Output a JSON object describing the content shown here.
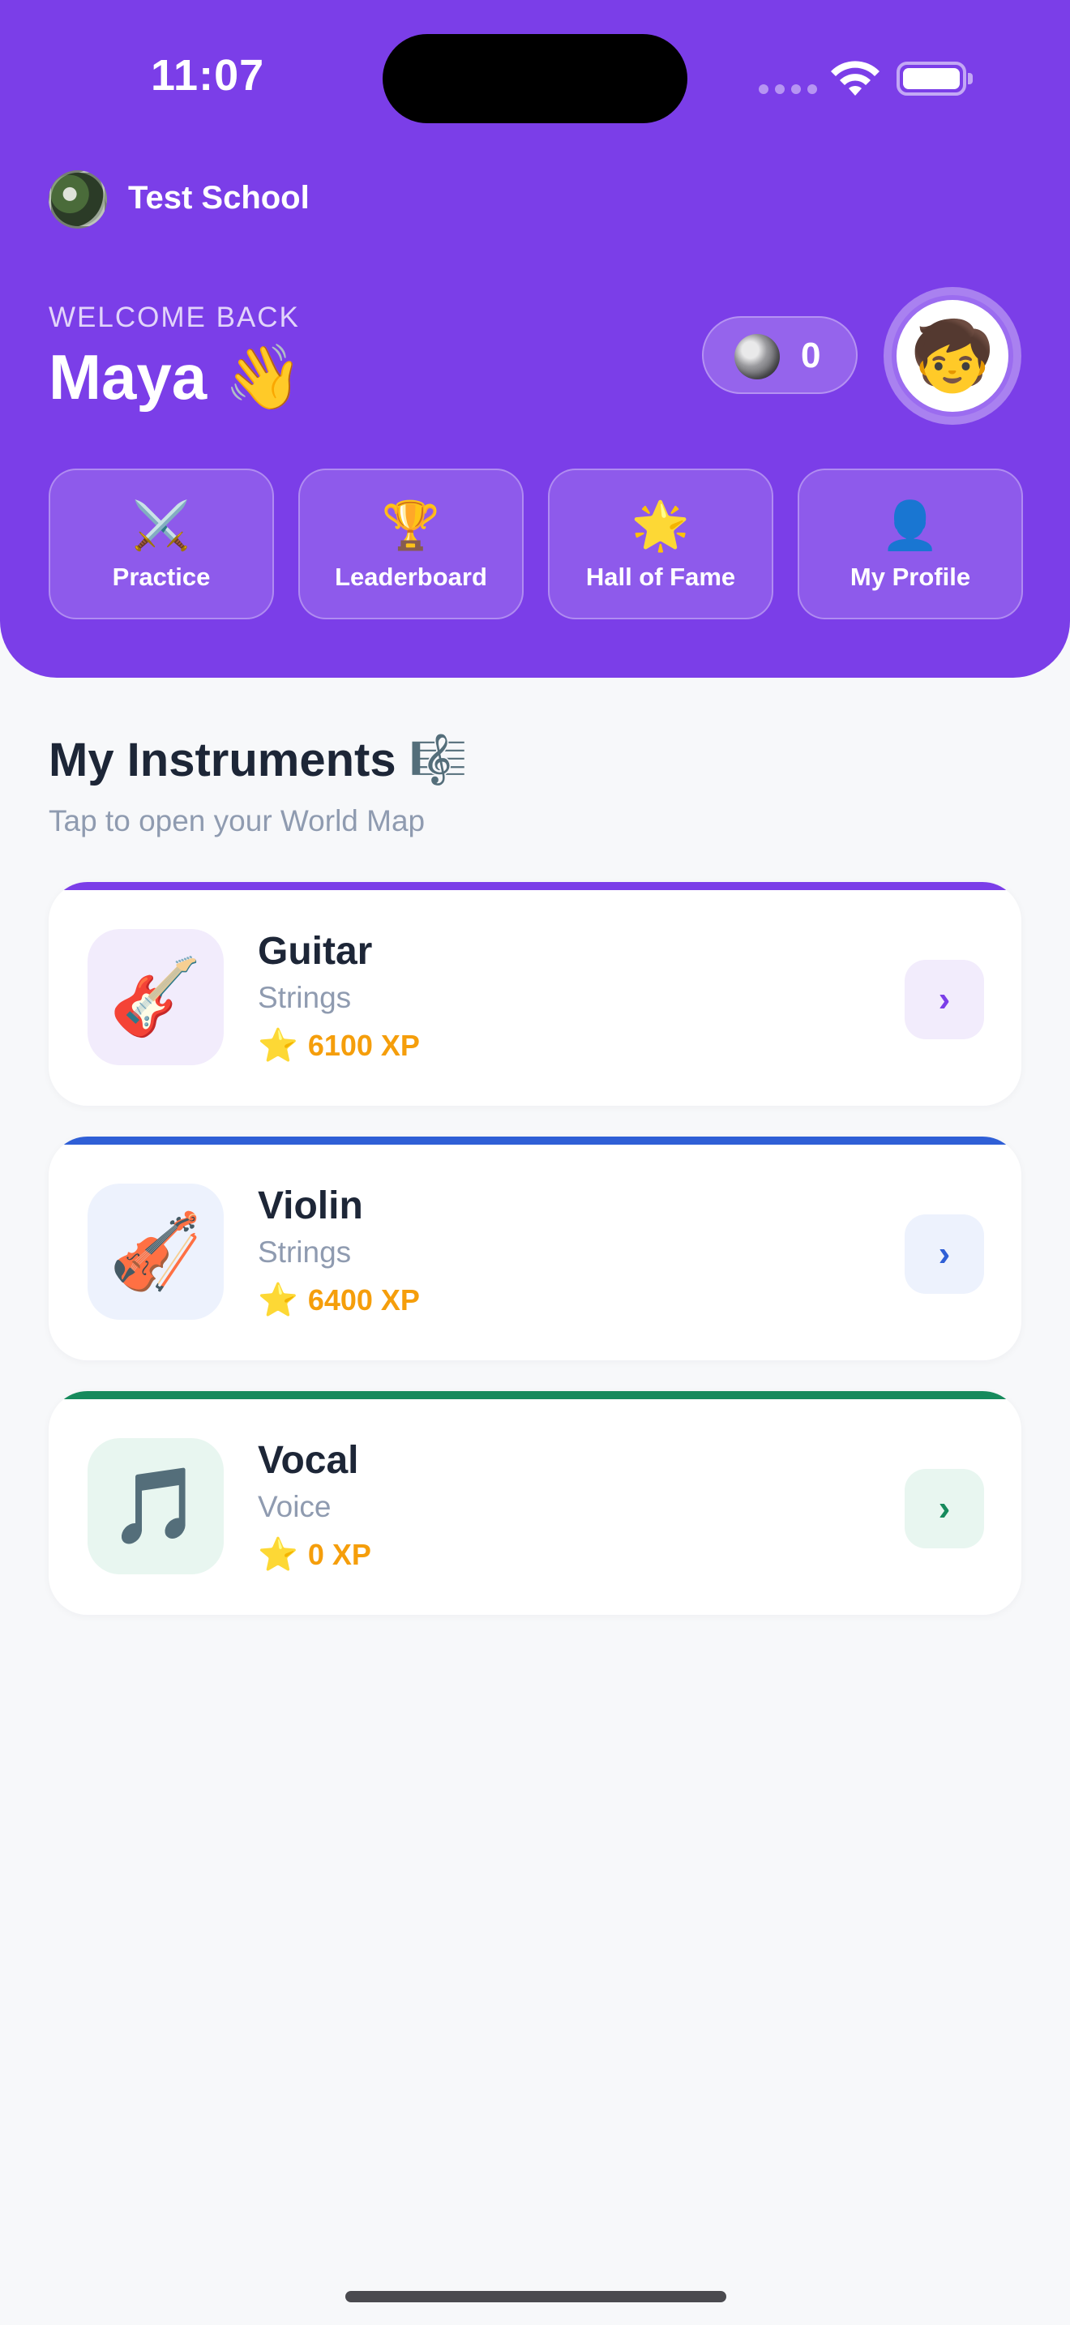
{
  "status_bar": {
    "time": "11:07"
  },
  "school": {
    "name": "Test School",
    "logo_icon": "school-logo-icon"
  },
  "welcome": {
    "label": "WELCOME BACK",
    "name": "Maya",
    "wave": "👋"
  },
  "coins": {
    "icon": "coin-icon",
    "count": "0"
  },
  "avatar": {
    "icon": "avatar-character-icon",
    "glyph": "🧒"
  },
  "actions": [
    {
      "label": "Practice",
      "icon": "⚔️"
    },
    {
      "label": "Leaderboard",
      "icon": "🏆"
    },
    {
      "label": "Hall of Fame",
      "icon": "🌟"
    },
    {
      "label": "My Profile",
      "icon": "👤"
    }
  ],
  "section": {
    "title": "My Instruments 🎼",
    "subtitle": "Tap to open your World Map"
  },
  "instruments": [
    {
      "name": "Guitar",
      "category": "Strings",
      "xp": "6100 XP",
      "icon": "🎸",
      "accent": "#7b3ee8",
      "tint": "#f2ecfc",
      "chevron": "›"
    },
    {
      "name": "Violin",
      "category": "Strings",
      "xp": "6400 XP",
      "icon": "🎻",
      "accent": "#2f5fd6",
      "tint": "#edf2fd",
      "chevron": "›"
    },
    {
      "name": "Vocal",
      "category": "Voice",
      "xp": "0 XP",
      "icon": "🎵",
      "accent": "#168a5c",
      "tint": "#e8f6f0",
      "chevron": "›"
    }
  ],
  "colors": {
    "header": "#7b3ee8",
    "xp": "#f59e0b",
    "title": "#1d2637",
    "muted": "#8f9bb0"
  }
}
